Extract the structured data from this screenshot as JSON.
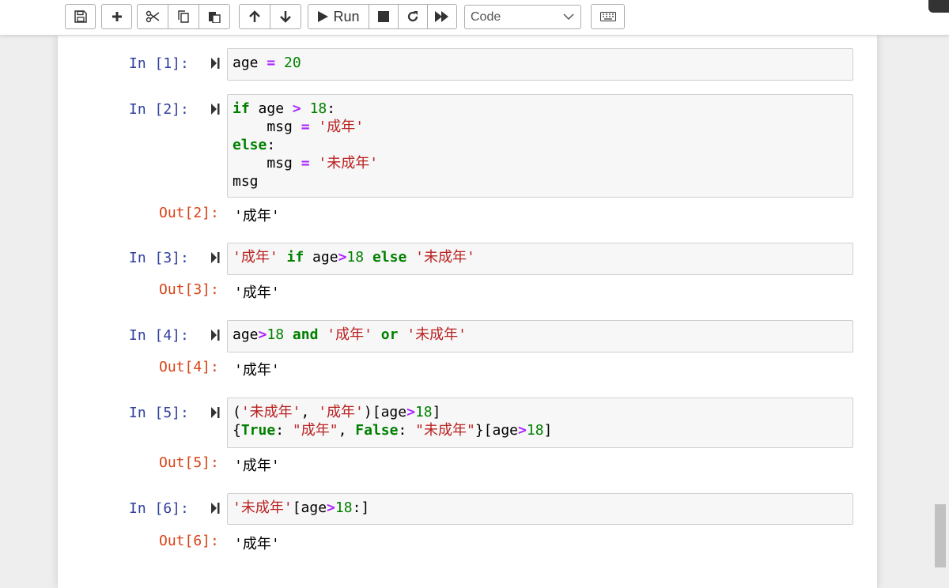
{
  "toolbar": {
    "run_label": "Run",
    "cell_type": "Code",
    "buttons": [
      "save-icon",
      "plus-icon",
      "scissors-icon",
      "copy-icon",
      "paste-icon",
      "arrow-up-icon",
      "arrow-down-icon",
      "play-icon",
      "stop-icon",
      "restart-icon",
      "fast-forward-icon",
      "keyboard-icon"
    ]
  },
  "cells": [
    {
      "in": "In [1]:",
      "code": [
        [
          [
            "age",
            ""
          ],
          [
            " = ",
            "op"
          ],
          [
            "20",
            "num"
          ]
        ]
      ]
    },
    {
      "in": "In [2]:",
      "code": [
        [
          [
            "if",
            "kw"
          ],
          [
            " age ",
            ""
          ],
          [
            ">",
            "op"
          ],
          [
            " ",
            ""
          ],
          [
            "18",
            "num"
          ],
          [
            ":",
            ""
          ]
        ],
        [
          [
            "    msg ",
            ""
          ],
          [
            "=",
            "op"
          ],
          [
            " ",
            ""
          ],
          [
            "'成年'",
            "str"
          ]
        ],
        [
          [
            "else",
            "kw"
          ],
          [
            ":",
            ""
          ]
        ],
        [
          [
            "    msg ",
            ""
          ],
          [
            "=",
            "op"
          ],
          [
            " ",
            ""
          ],
          [
            "'未成年'",
            "str"
          ]
        ],
        [
          [
            "msg",
            ""
          ]
        ]
      ],
      "out": "Out[2]:",
      "result": "'成年'"
    },
    {
      "in": "In [3]:",
      "code": [
        [
          [
            "'成年'",
            "str"
          ],
          [
            " ",
            ""
          ],
          [
            "if",
            "kw"
          ],
          [
            " age",
            ""
          ],
          [
            ">",
            "op"
          ],
          [
            "18",
            "num"
          ],
          [
            " ",
            ""
          ],
          [
            "else",
            "kw"
          ],
          [
            " ",
            ""
          ],
          [
            "'未成年'",
            "str"
          ]
        ]
      ],
      "out": "Out[3]:",
      "result": "'成年'"
    },
    {
      "in": "In [4]:",
      "code": [
        [
          [
            "age",
            ""
          ],
          [
            ">",
            "op"
          ],
          [
            "18",
            "num"
          ],
          [
            " ",
            ""
          ],
          [
            "and",
            "kw"
          ],
          [
            " ",
            ""
          ],
          [
            "'成年'",
            "str"
          ],
          [
            " ",
            ""
          ],
          [
            "or",
            "kw"
          ],
          [
            " ",
            ""
          ],
          [
            "'未成年'",
            "str"
          ]
        ]
      ],
      "out": "Out[4]:",
      "result": "'成年'"
    },
    {
      "in": "In [5]:",
      "code": [
        [
          [
            "(",
            ""
          ],
          [
            "'未成年'",
            "str"
          ],
          [
            ", ",
            ""
          ],
          [
            "'成年'",
            "str"
          ],
          [
            ")[age",
            ""
          ],
          [
            ">",
            "op"
          ],
          [
            "18",
            "num"
          ],
          [
            "]",
            ""
          ]
        ],
        [
          [
            "{",
            ""
          ],
          [
            "True",
            "kw"
          ],
          [
            ": ",
            ""
          ],
          [
            "\"成年\"",
            "str"
          ],
          [
            ", ",
            ""
          ],
          [
            "False",
            "kw"
          ],
          [
            ": ",
            ""
          ],
          [
            "\"未成年\"",
            "str"
          ],
          [
            "}[age",
            ""
          ],
          [
            ">",
            "op"
          ],
          [
            "18",
            "num"
          ],
          [
            "]",
            ""
          ]
        ]
      ],
      "out": "Out[5]:",
      "result": "'成年'"
    },
    {
      "in": "In [6]:",
      "code": [
        [
          [
            "'未成年'",
            "str"
          ],
          [
            "[age",
            ""
          ],
          [
            ">",
            "op"
          ],
          [
            "18",
            "num"
          ],
          [
            ":]",
            ""
          ]
        ]
      ],
      "out": "Out[6]:",
      "result": "'成年'"
    }
  ]
}
